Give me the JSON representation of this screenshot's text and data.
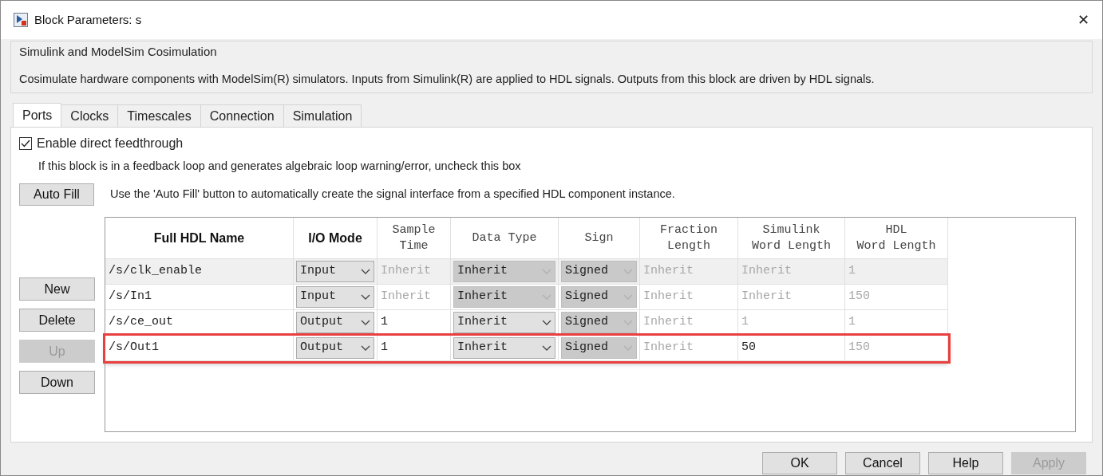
{
  "window": {
    "title": "Block Parameters: s",
    "close": "✕"
  },
  "group": {
    "title": "Simulink and ModelSim Cosimulation",
    "description": "Cosimulate hardware components with ModelSim(R) simulators. Inputs from Simulink(R) are applied to HDL signals. Outputs from this block are driven by HDL signals."
  },
  "tabs": [
    {
      "label": "Ports",
      "selected": true
    },
    {
      "label": "Clocks",
      "selected": false
    },
    {
      "label": "Timescales",
      "selected": false
    },
    {
      "label": "Connection",
      "selected": false
    },
    {
      "label": "Simulation",
      "selected": false
    }
  ],
  "feedthrough": {
    "label": "Enable direct feedthrough",
    "checked": true,
    "hint": "If this block is in a feedback loop and generates algebraic loop warning/error, uncheck this box"
  },
  "auto_fill": {
    "button": "Auto Fill",
    "hint": "Use the 'Auto Fill' button to automatically create the signal interface from a specified HDL component instance."
  },
  "side_buttons": [
    {
      "label": "New",
      "disabled": false
    },
    {
      "label": "Delete",
      "disabled": false
    },
    {
      "label": "Up",
      "disabled": true
    },
    {
      "label": "Down",
      "disabled": false
    }
  ],
  "table": {
    "columns": [
      {
        "label": "Full HDL Name",
        "kind": "bold"
      },
      {
        "label": "I/O Mode",
        "kind": "bold"
      },
      {
        "label": "Sample\nTime",
        "kind": "mono"
      },
      {
        "label": "Data Type",
        "kind": "mono"
      },
      {
        "label": "Sign",
        "kind": "mono"
      },
      {
        "label": "Fraction\nLength",
        "kind": "mono"
      },
      {
        "label": "Simulink\nWord Length",
        "kind": "mono"
      },
      {
        "label": "HDL\nWord Length",
        "kind": "mono"
      }
    ],
    "rows": [
      {
        "selected": true,
        "highlighted": false,
        "cells": [
          {
            "kind": "text",
            "value": "/s/clk_enable",
            "disabled": false
          },
          {
            "kind": "dropdown",
            "value": "Input",
            "disabled": false
          },
          {
            "kind": "text",
            "value": "Inherit",
            "disabled": true
          },
          {
            "kind": "dropdown",
            "value": "Inherit",
            "disabled": true
          },
          {
            "kind": "dropdown",
            "value": "Signed",
            "disabled": true
          },
          {
            "kind": "text",
            "value": "Inherit",
            "disabled": true
          },
          {
            "kind": "text",
            "value": "Inherit",
            "disabled": true
          },
          {
            "kind": "text",
            "value": "1",
            "disabled": true
          }
        ]
      },
      {
        "selected": false,
        "highlighted": false,
        "cells": [
          {
            "kind": "text",
            "value": "/s/In1",
            "disabled": false
          },
          {
            "kind": "dropdown",
            "value": "Input",
            "disabled": false
          },
          {
            "kind": "text",
            "value": "Inherit",
            "disabled": true
          },
          {
            "kind": "dropdown",
            "value": "Inherit",
            "disabled": true
          },
          {
            "kind": "dropdown",
            "value": "Signed",
            "disabled": true
          },
          {
            "kind": "text",
            "value": "Inherit",
            "disabled": true
          },
          {
            "kind": "text",
            "value": "Inherit",
            "disabled": true
          },
          {
            "kind": "text",
            "value": "150",
            "disabled": true
          }
        ]
      },
      {
        "selected": false,
        "highlighted": false,
        "cells": [
          {
            "kind": "text",
            "value": "/s/ce_out",
            "disabled": false
          },
          {
            "kind": "dropdown",
            "value": "Output",
            "disabled": false
          },
          {
            "kind": "text",
            "value": "1",
            "disabled": false
          },
          {
            "kind": "dropdown",
            "value": "Inherit",
            "disabled": false
          },
          {
            "kind": "dropdown",
            "value": "Signed",
            "disabled": true
          },
          {
            "kind": "text",
            "value": "Inherit",
            "disabled": true
          },
          {
            "kind": "text",
            "value": "1",
            "disabled": true
          },
          {
            "kind": "text",
            "value": "1",
            "disabled": true
          }
        ]
      },
      {
        "selected": false,
        "highlighted": true,
        "cells": [
          {
            "kind": "text",
            "value": "/s/Out1",
            "disabled": false
          },
          {
            "kind": "dropdown",
            "value": "Output",
            "disabled": false
          },
          {
            "kind": "text",
            "value": "1",
            "disabled": false
          },
          {
            "kind": "dropdown",
            "value": "Inherit",
            "disabled": false
          },
          {
            "kind": "dropdown",
            "value": "Signed",
            "disabled": true
          },
          {
            "kind": "text",
            "value": "Inherit",
            "disabled": true
          },
          {
            "kind": "text",
            "value": "50",
            "disabled": false
          },
          {
            "kind": "text",
            "value": "150",
            "disabled": true
          }
        ]
      }
    ]
  },
  "footer_buttons": [
    {
      "label": "OK",
      "disabled": false
    },
    {
      "label": "Cancel",
      "disabled": false
    },
    {
      "label": "Help",
      "disabled": false
    },
    {
      "label": "Apply",
      "disabled": true
    }
  ]
}
